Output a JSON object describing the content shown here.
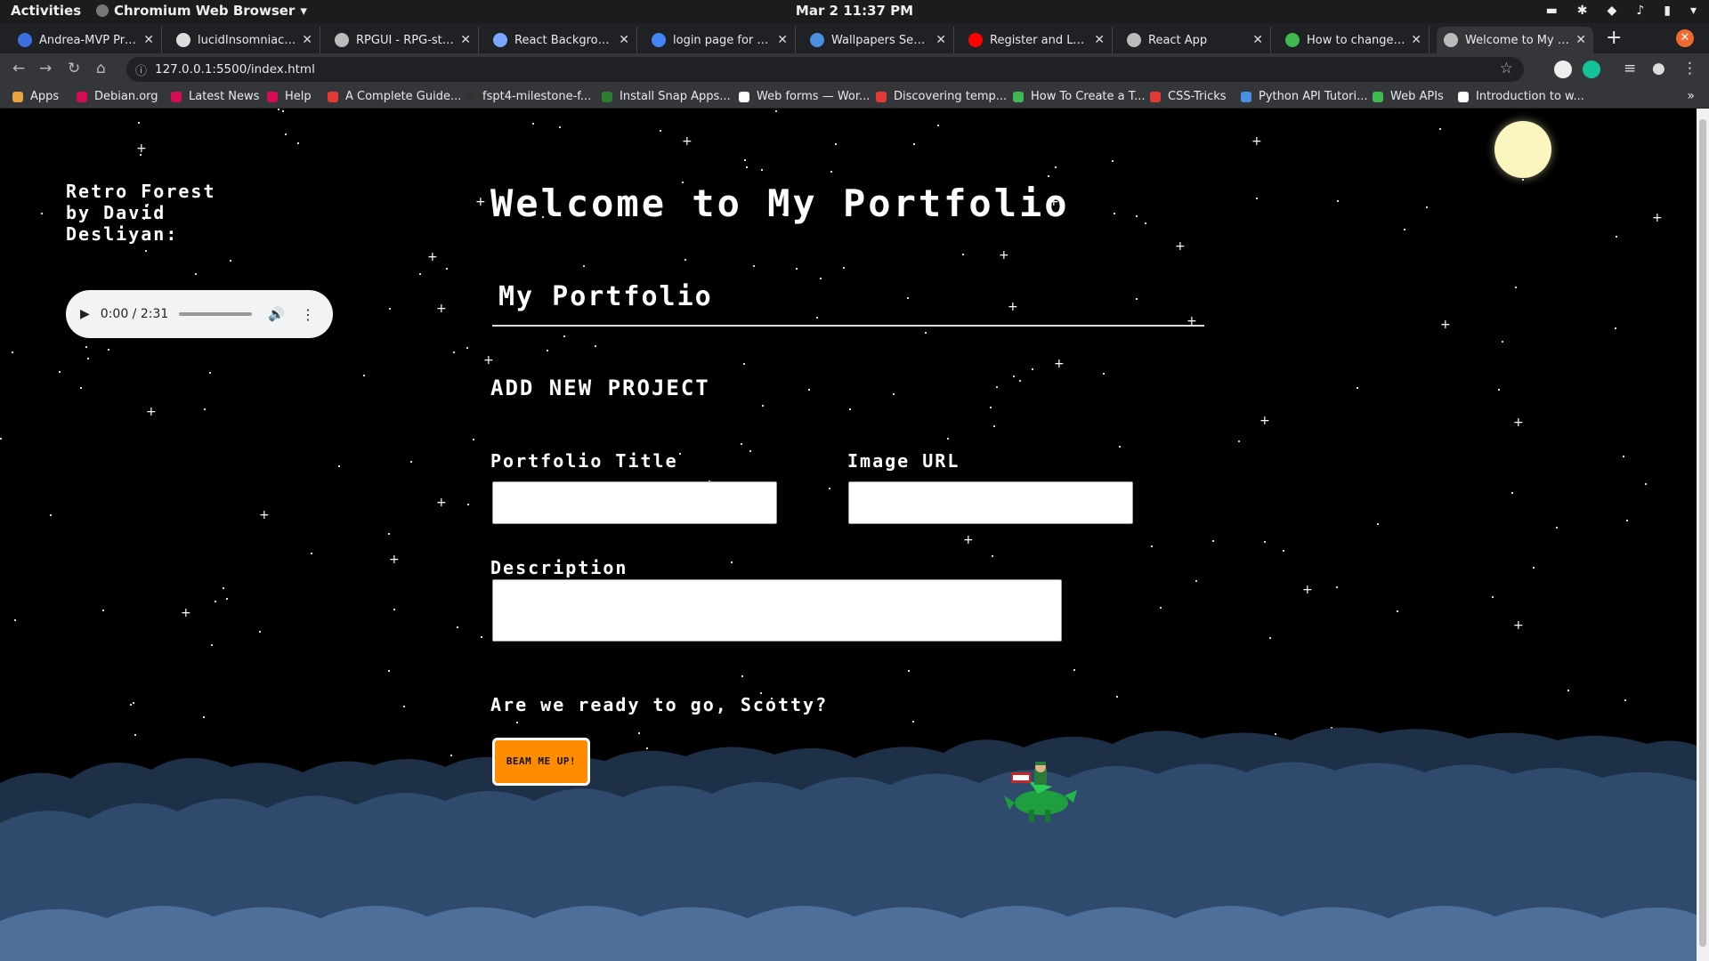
{
  "os_bar": {
    "activities": "Activities",
    "app_name": "Chromium Web Browser",
    "clock": "Mar 2  11:37 PM"
  },
  "tabs": [
    {
      "label": "Andrea-MVP Proj - I",
      "color": "#3b6fe0"
    },
    {
      "label": "lucidInsomniac/Co",
      "color": "#dddddd"
    },
    {
      "label": "RPGUI - RPG-style g",
      "color": "#bbbbbb"
    },
    {
      "label": "React Background I",
      "color": "#7aa6ff"
    },
    {
      "label": "login page for pixel",
      "color": "#4285f4"
    },
    {
      "label": "Wallpapers Search:",
      "color": "#4a90e2"
    },
    {
      "label": "Register and Login",
      "color": "#ff0000"
    },
    {
      "label": "React App",
      "color": "#bbbbbb"
    },
    {
      "label": "How to change the",
      "color": "#3fb950"
    },
    {
      "label": "Welcome to My Por",
      "color": "#bbbbbb",
      "active": true
    }
  ],
  "address_bar": {
    "url": "127.0.0.1:5500/index.html"
  },
  "bookmarks": [
    {
      "label": "Apps",
      "color": "#e8a33d"
    },
    {
      "label": "Debian.org",
      "color": "#d70a53"
    },
    {
      "label": "Latest News",
      "color": "#d70a53"
    },
    {
      "label": "Help",
      "color": "#d70a53"
    },
    {
      "label": "A Complete Guide...",
      "color": "#e53935"
    },
    {
      "label": "fspt4-milestone-f...",
      "color": "#333333"
    },
    {
      "label": "Install Snap Apps...",
      "color": "#2e7d32"
    },
    {
      "label": "Web forms — Wor...",
      "color": "#ffffff"
    },
    {
      "label": "Discovering temp...",
      "color": "#e53935"
    },
    {
      "label": "How To Create a T...",
      "color": "#3fb950"
    },
    {
      "label": "CSS-Tricks",
      "color": "#e53935"
    },
    {
      "label": "Python API Tutori...",
      "color": "#4a90e2"
    },
    {
      "label": "Web APIs",
      "color": "#3fb950"
    },
    {
      "label": "Introduction to w...",
      "color": "#ffffff"
    }
  ],
  "page": {
    "audio_title": "Retro Forest by David Desliyan:",
    "audio_time": "0:00 / 2:31",
    "heading": "Welcome to My Portfolio",
    "subheading": "My Portfolio",
    "section_title": "ADD NEW PROJECT",
    "form": {
      "title_label": "Portfolio Title",
      "title_value": "",
      "image_label": "Image URL",
      "image_value": "",
      "description_label": "Description",
      "description_value": ""
    },
    "ready_text": "Are we ready to go, Scotty?",
    "submit_label": "BEAM ME UP!"
  },
  "colors": {
    "button": "#ff8c00",
    "moon": "#fbf6c0",
    "cloud_front": "#2f4a6d",
    "cloud_back": "#1e3048"
  }
}
